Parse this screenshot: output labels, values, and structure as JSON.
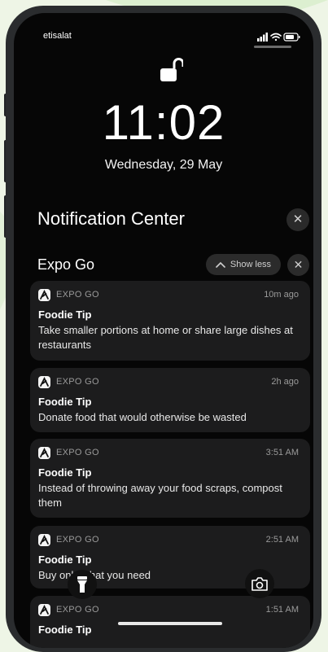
{
  "status_bar": {
    "carrier": "etisalat"
  },
  "lock_screen": {
    "time": "11:02",
    "date": "Wednesday, 29 May"
  },
  "notification_center": {
    "title": "Notification Center",
    "close_symbol": "✕"
  },
  "group": {
    "title": "Expo Go",
    "show_less_label": "Show less",
    "close_symbol": "✕"
  },
  "notifications": [
    {
      "app": "EXPO GO",
      "time": "10m ago",
      "title": "Foodie Tip",
      "body": "Take smaller portions at home or share large dishes at restaurants"
    },
    {
      "app": "EXPO GO",
      "time": "2h ago",
      "title": "Foodie Tip",
      "body": "Donate food that would otherwise be wasted"
    },
    {
      "app": "EXPO GO",
      "time": "3:51 AM",
      "title": "Foodie Tip",
      "body": "Instead of throwing away your food scraps, compost them"
    },
    {
      "app": "EXPO GO",
      "time": "2:51 AM",
      "title": "Foodie Tip",
      "body": "Buy only what you need"
    },
    {
      "app": "EXPO GO",
      "time": "1:51 AM",
      "title": "Foodie Tip",
      "body": ""
    }
  ],
  "icons": {
    "signal": "signal-icon",
    "wifi": "wifi-icon",
    "battery": "battery-icon",
    "lock": "unlocked-padlock-icon",
    "app": "expo-go-icon",
    "flashlight": "flashlight-icon",
    "camera": "camera-icon"
  }
}
